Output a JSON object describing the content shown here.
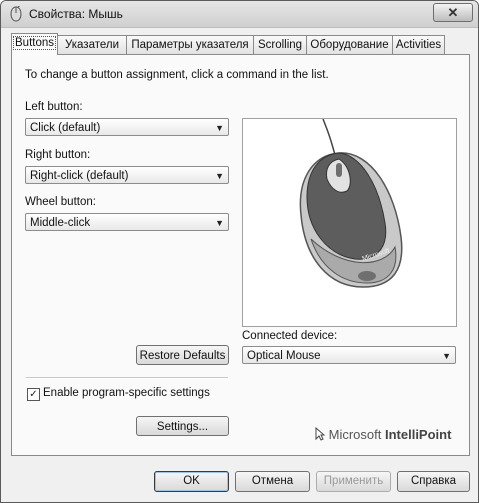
{
  "window": {
    "title": "Свойства: Мышь",
    "close_glyph": "✕"
  },
  "tabs": [
    {
      "label": "Buttons",
      "active": true
    },
    {
      "label": "Указатели"
    },
    {
      "label": "Параметры указателя"
    },
    {
      "label": "Scrolling"
    },
    {
      "label": "Оборудование"
    },
    {
      "label": "Activities"
    }
  ],
  "buttons_tab": {
    "instruction": "To change a button assignment, click a command in the list.",
    "left_button": {
      "label": "Left button:",
      "value": "Click (default)"
    },
    "right_button": {
      "label": "Right button:",
      "value": "Right-click (default)"
    },
    "wheel_button": {
      "label": "Wheel button:",
      "value": "Middle-click"
    },
    "restore_defaults": "Restore Defaults",
    "connected_device": {
      "label": "Connected device:",
      "value": "Optical Mouse"
    },
    "enable_program_specific": {
      "label": "Enable program-specific settings",
      "checked": true
    },
    "settings_button": "Settings...",
    "brand": {
      "prefix": "Microsoft",
      "name": "IntelliPoint"
    },
    "mouse_logo_text": "Microsoft"
  },
  "dialog_buttons": {
    "ok": "OK",
    "cancel": "Отмена",
    "apply": "Применить",
    "help": "Справка"
  },
  "icons": [
    "mouse-icon",
    "close-icon",
    "dropdown-arrow-icon",
    "checkmark-icon",
    "intellipoint-logo-icon"
  ]
}
